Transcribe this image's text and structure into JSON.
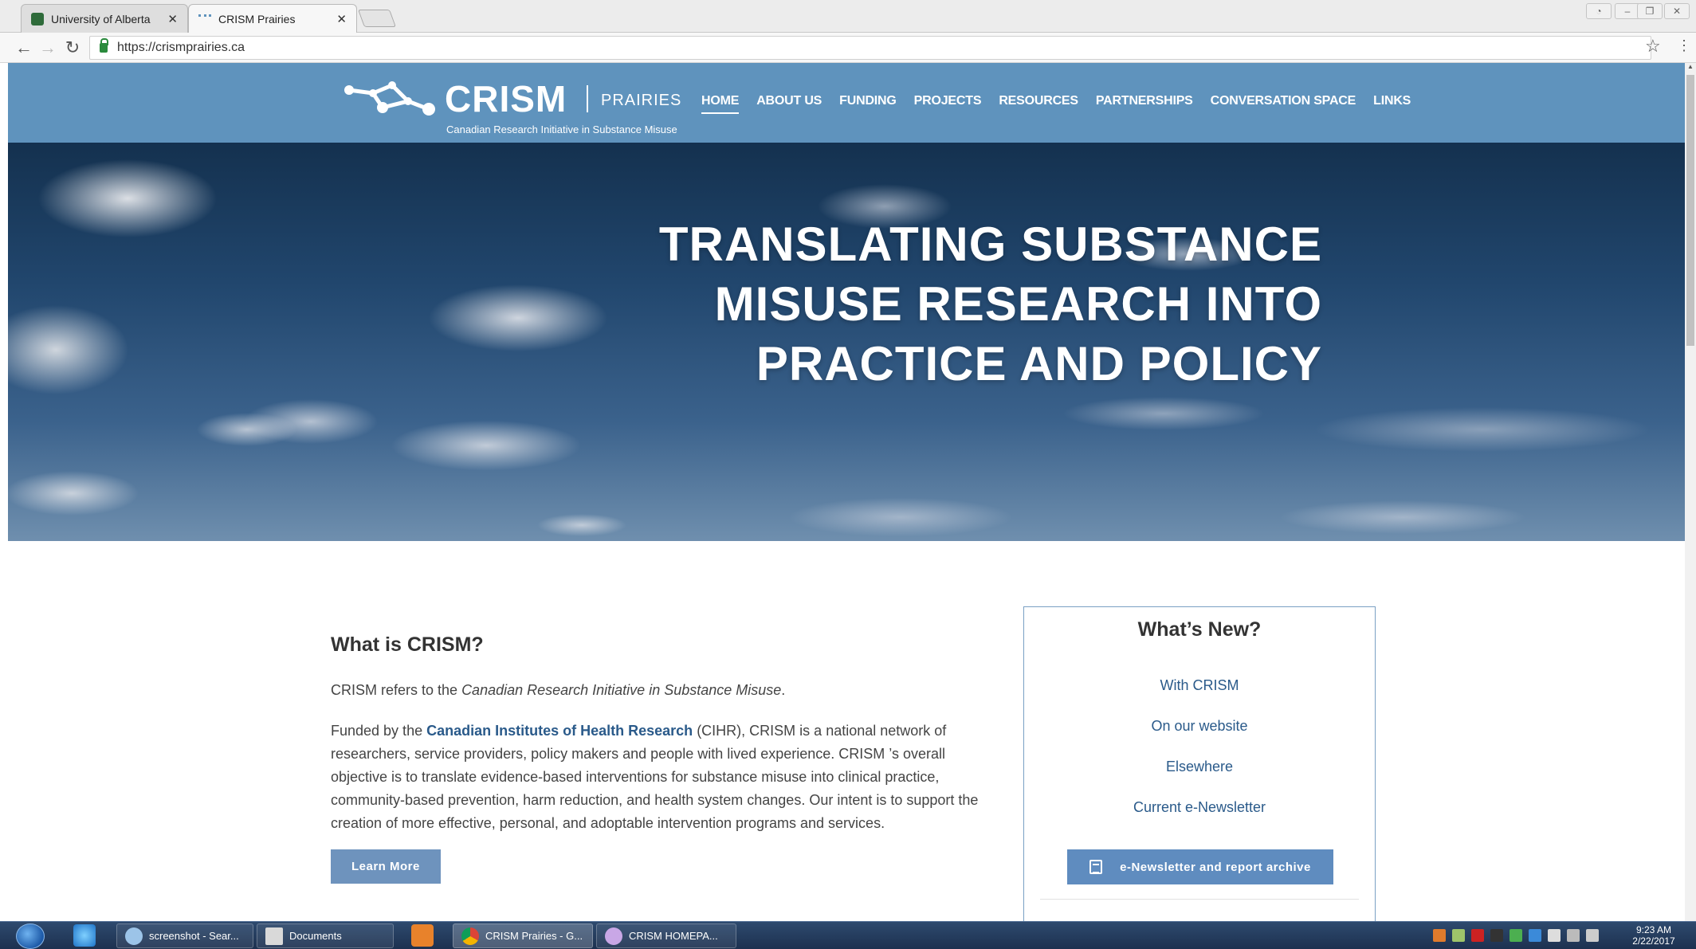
{
  "browser": {
    "tabs": [
      {
        "title": "University of Alberta",
        "active": false
      },
      {
        "title": "CRISM Prairies",
        "active": true
      }
    ],
    "url": "https://crismprairies.ca"
  },
  "site": {
    "logo": {
      "word": "CRISM",
      "region": "PRAIRIES",
      "tagline": "Canadian Research Initiative in Substance Misuse"
    },
    "nav": [
      {
        "label": "HOME",
        "active": true
      },
      {
        "label": "ABOUT US"
      },
      {
        "label": "FUNDING"
      },
      {
        "label": "PROJECTS"
      },
      {
        "label": "RESOURCES"
      },
      {
        "label": "PARTNERSHIPS"
      },
      {
        "label": "CONVERSATION SPACE"
      },
      {
        "label": "LINKS"
      }
    ],
    "hero": {
      "lines": [
        "TRANSLATING SUBSTANCE",
        "MISUSE RESEARCH INTO",
        "PRACTICE AND POLICY"
      ]
    },
    "about": {
      "heading": "What is CRISM?",
      "intro_prefix": "CRISM refers to the ",
      "intro_italic": "Canadian Research Initiative in Substance Misuse",
      "intro_suffix": ".",
      "body_prefix": "Funded by the ",
      "body_link": "Canadian Institutes of Health Research",
      "body_suffix": " (CIHR), CRISM is a national network of researchers, service providers, policy makers and people with lived experience.  CRISM ’s overall objective is to translate evidence-based interventions for substance misuse into clinical practice, community-based prevention, harm reduction, and health system changes.  Our intent is to support the creation of more effective, personal, and adoptable intervention programs and services.",
      "button": "Learn More"
    },
    "whats_new": {
      "title": "What’s New?",
      "links": [
        "With CRISM",
        "On our website",
        "Elsewhere",
        "Current e-Newsletter"
      ],
      "archive_button": "e-Newsletter and report archive"
    }
  },
  "taskbar": {
    "tasks": [
      "screenshot - Sear...",
      "Documents",
      "CRISM Prairies - G...",
      "CRISM HOMEPA..."
    ],
    "time": "9:23 AM",
    "date": "2/22/2017"
  },
  "colors": {
    "header": "#5f93bd",
    "button": "#6e93bd",
    "link": "#2a5a8a"
  }
}
